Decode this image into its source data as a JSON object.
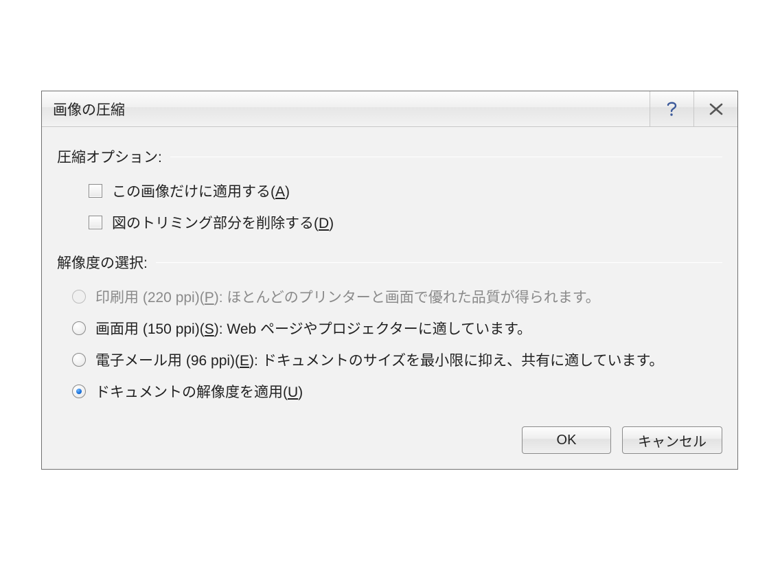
{
  "dialog": {
    "title": "画像の圧縮",
    "titlebar_buttons": {
      "help": "?",
      "close": "✕"
    }
  },
  "compression_options": {
    "heading": "圧縮オプション:",
    "apply_only_this": {
      "label_pre": "この画像だけに適用する(",
      "hotkey": "A",
      "label_post": ")",
      "checked": false
    },
    "delete_cropped": {
      "label_pre": "図のトリミング部分を削除する(",
      "hotkey": "D",
      "label_post": ")",
      "checked": false
    }
  },
  "resolution": {
    "heading": "解像度の選択:",
    "options": [
      {
        "id": "print",
        "label_pre": "印刷用 (220 ppi)(",
        "hotkey": "P",
        "label_post": "): ほとんどのプリンターと画面で優れた品質が得られます。",
        "checked": false,
        "disabled": true
      },
      {
        "id": "screen",
        "label_pre": "画面用 (150 ppi)(",
        "hotkey": "S",
        "label_post": "): Web ページやプロジェクターに適しています。",
        "checked": false,
        "disabled": false
      },
      {
        "id": "email",
        "label_pre": "電子メール用 (96 ppi)(",
        "hotkey": "E",
        "label_post": "): ドキュメントのサイズを最小限に抑え、共有に適しています。",
        "checked": false,
        "disabled": false
      },
      {
        "id": "doc",
        "label_pre": "ドキュメントの解像度を適用(",
        "hotkey": "U",
        "label_post": ")",
        "checked": true,
        "disabled": false
      }
    ]
  },
  "buttons": {
    "ok": "OK",
    "cancel": "キャンセル"
  }
}
